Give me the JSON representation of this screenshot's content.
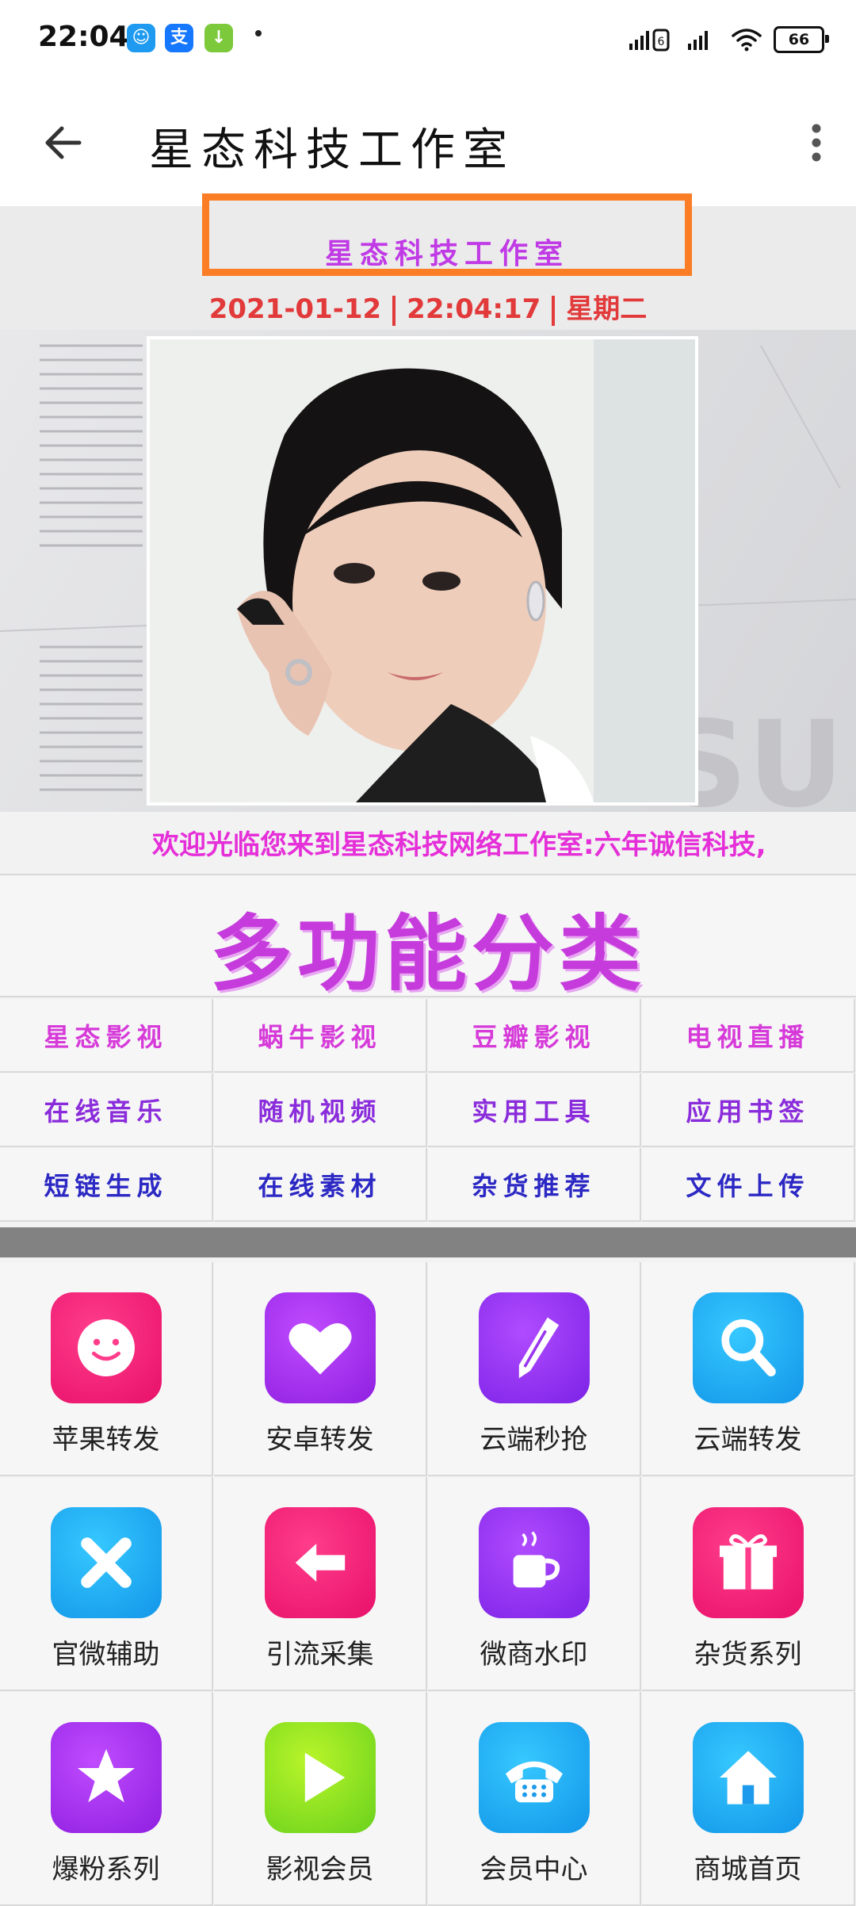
{
  "status_bar": {
    "time": "22:04",
    "apps": [
      {
        "icon": "store-icon",
        "glyph": "☺",
        "color": "#1e9bf0"
      },
      {
        "icon": "alipay-icon",
        "glyph": "支",
        "color": "#1677ff"
      },
      {
        "icon": "download-icon",
        "glyph": "↓",
        "color": "#7cc93b"
      }
    ],
    "battery": "66"
  },
  "app_bar": {
    "title": "星态科技工作室"
  },
  "header": {
    "site_title": "星态科技工作室",
    "date": "2021-01-12",
    "time": "22:04:17",
    "weekday": "星期二"
  },
  "marquee": {
    "text": "欢迎光临您来到星态科技网络工作室:六年诚信科技,"
  },
  "section": {
    "heading": "多功能分类"
  },
  "links": [
    {
      "label": "星态影视",
      "color": "#d63ad9"
    },
    {
      "label": "蜗牛影视",
      "color": "#d63ad9"
    },
    {
      "label": "豆瓣影视",
      "color": "#d63ad9"
    },
    {
      "label": "电视直播",
      "color": "#d63ad9"
    },
    {
      "label": "在线音乐",
      "color": "#8a2cdb"
    },
    {
      "label": "随机视频",
      "color": "#8a2cdb"
    },
    {
      "label": "实用工具",
      "color": "#8a2cdb"
    },
    {
      "label": "应用书签",
      "color": "#8a2cdb"
    },
    {
      "label": "短链生成",
      "color": "#2c28c4"
    },
    {
      "label": "在线素材",
      "color": "#2c28c4"
    },
    {
      "label": "杂货推荐",
      "color": "#2c28c4"
    },
    {
      "label": "文件上传",
      "color": "#2c28c4"
    }
  ],
  "tiles": [
    {
      "label": "苹果转发",
      "icon": "smiley-icon",
      "colors": [
        "#ff3d8b",
        "#e8106a"
      ]
    },
    {
      "label": "安卓转发",
      "icon": "heart-icon",
      "colors": [
        "#c04bff",
        "#8f1fe0"
      ]
    },
    {
      "label": "云端秒抢",
      "icon": "pencil-icon",
      "colors": [
        "#b04bff",
        "#7c22e6"
      ]
    },
    {
      "label": "云端转发",
      "icon": "search-icon",
      "colors": [
        "#36c8ff",
        "#1296e8"
      ]
    },
    {
      "label": "官微辅助",
      "icon": "close-icon",
      "colors": [
        "#36c8ff",
        "#1296e8"
      ]
    },
    {
      "label": "引流采集",
      "icon": "arrow-left-icon",
      "colors": [
        "#ff3d8b",
        "#e8106a"
      ]
    },
    {
      "label": "微商水印",
      "icon": "coffee-cup-icon",
      "colors": [
        "#b04bff",
        "#7c22e6"
      ]
    },
    {
      "label": "杂货系列",
      "icon": "gift-icon",
      "colors": [
        "#ff3d8b",
        "#e8106a"
      ]
    },
    {
      "label": "爆粉系列",
      "icon": "star-icon",
      "colors": [
        "#c04bff",
        "#8f1fe0"
      ]
    },
    {
      "label": "影视会员",
      "icon": "play-icon",
      "colors": [
        "#b9f52a",
        "#69d11c"
      ]
    },
    {
      "label": "会员中心",
      "icon": "telephone-icon",
      "colors": [
        "#36c8ff",
        "#1296e8"
      ]
    },
    {
      "label": "商城首页",
      "icon": "home-icon",
      "colors": [
        "#36c8ff",
        "#1296e8"
      ]
    }
  ]
}
